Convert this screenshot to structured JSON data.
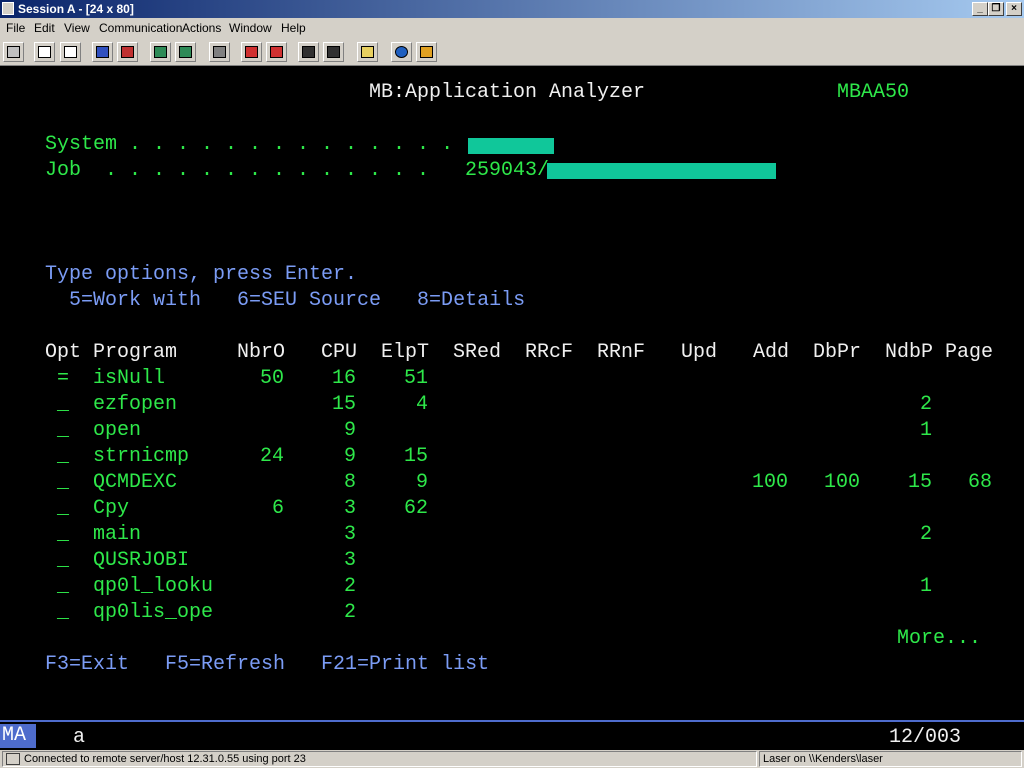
{
  "window": {
    "title": "Session A - [24 x 80]"
  },
  "menu": [
    {
      "label": "File"
    },
    {
      "label": "Edit"
    },
    {
      "label": "View"
    },
    {
      "label": "Communication"
    },
    {
      "label": "Actions"
    },
    {
      "label": "Window"
    },
    {
      "label": "Help"
    }
  ],
  "screen": {
    "title": "MB:Application Analyzer",
    "program_id": "MBAA50",
    "system_label": "System . . . . . . . . . . . . . .",
    "system_value": "",
    "job_label": "Job  . . . . . . . . . . . . . .",
    "job_value": "259043/",
    "instructions": "Type options, press Enter.",
    "options_line": "5=Work with   6=SEU Source   8=Details",
    "columns": [
      "Opt",
      "Program",
      "NbrO",
      "CPU",
      "ElpT",
      "SRed",
      "RRcF",
      "RRnF",
      "Upd",
      "Add",
      "DbPr",
      "NdbP",
      "Page"
    ],
    "rows": [
      {
        "opt": "=",
        "program": "isNull",
        "nbro": "50",
        "cpu": "16",
        "elpt": "51",
        "add": "",
        "dbpr": "",
        "ndbp": "",
        "page": ""
      },
      {
        "opt": "_",
        "program": "ezfopen",
        "nbro": "",
        "cpu": "15",
        "elpt": "4",
        "add": "",
        "dbpr": "",
        "ndbp": "2",
        "page": ""
      },
      {
        "opt": "_",
        "program": "open",
        "nbro": "",
        "cpu": "9",
        "elpt": "",
        "add": "",
        "dbpr": "",
        "ndbp": "1",
        "page": ""
      },
      {
        "opt": "_",
        "program": "strnicmp",
        "nbro": "24",
        "cpu": "9",
        "elpt": "15",
        "add": "",
        "dbpr": "",
        "ndbp": "",
        "page": ""
      },
      {
        "opt": "_",
        "program": "QCMDEXC",
        "nbro": "",
        "cpu": "8",
        "elpt": "9",
        "add": "100",
        "dbpr": "100",
        "ndbp": "15",
        "page": "68"
      },
      {
        "opt": "_",
        "program": "Cpy",
        "nbro": "6",
        "cpu": "3",
        "elpt": "62",
        "add": "",
        "dbpr": "",
        "ndbp": "",
        "page": ""
      },
      {
        "opt": "_",
        "program": "main",
        "nbro": "",
        "cpu": "3",
        "elpt": "",
        "add": "",
        "dbpr": "",
        "ndbp": "2",
        "page": ""
      },
      {
        "opt": "_",
        "program": "QUSRJOBI",
        "nbro": "",
        "cpu": "3",
        "elpt": "",
        "add": "",
        "dbpr": "",
        "ndbp": "",
        "page": ""
      },
      {
        "opt": "_",
        "program": "qp0l_looku",
        "nbro": "",
        "cpu": "2",
        "elpt": "",
        "add": "",
        "dbpr": "",
        "ndbp": "1",
        "page": ""
      },
      {
        "opt": "_",
        "program": "qp0lis_ope",
        "nbro": "",
        "cpu": "2",
        "elpt": "",
        "add": "",
        "dbpr": "",
        "ndbp": "",
        "page": ""
      }
    ],
    "more": "More...",
    "fkeys": "F3=Exit   F5=Refresh   F21=Print list"
  },
  "oia": {
    "mode": "MA",
    "indicator": "a",
    "cursor": "12/003"
  },
  "status": {
    "connection": "Connected to remote server/host 12.31.0.55 using port 23",
    "printer": "Laser on \\\\Kenders\\laser"
  },
  "colors": {
    "green": "#2ee84a",
    "blue": "#7b9cf5",
    "redaction": "#10c79a",
    "titlebar": "#0a246a"
  }
}
